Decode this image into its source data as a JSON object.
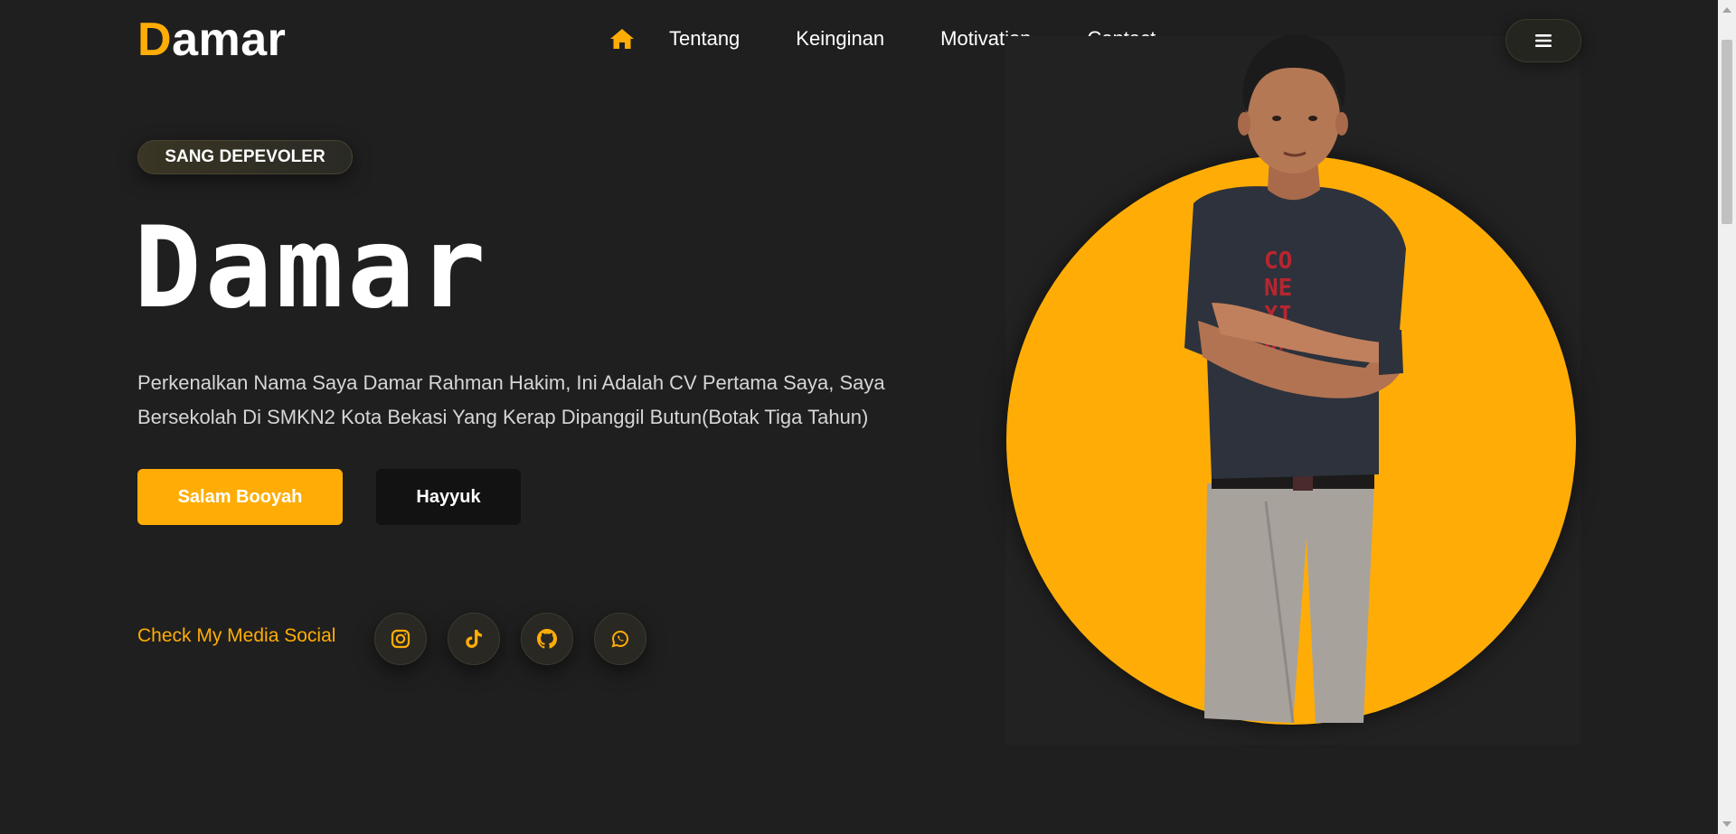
{
  "header": {
    "logo_first": "D",
    "logo_rest": "amar",
    "nav": [
      "Tentang",
      "Keinginan",
      "Motivation",
      "Contact"
    ]
  },
  "hero": {
    "badge": "SANG DEPEVOLER",
    "title": "Damar",
    "description": "Perkenalkan Nama Saya Damar Rahman Hakim, Ini Adalah CV Pertama Saya, Saya Bersekolah Di SMKN2 Kota Bekasi Yang Kerap Dipanggil Butun(Botak Tiga Tahun)",
    "primary_button": "Salam Booyah",
    "secondary_button": "Hayyuk"
  },
  "social": {
    "label": "Check My Media Social",
    "icons": [
      "instagram-icon",
      "tiktok-icon",
      "github-icon",
      "whatsapp-icon"
    ]
  },
  "colors": {
    "accent": "#ffad06",
    "background": "#1f1f1f",
    "text": "#ffffff"
  }
}
